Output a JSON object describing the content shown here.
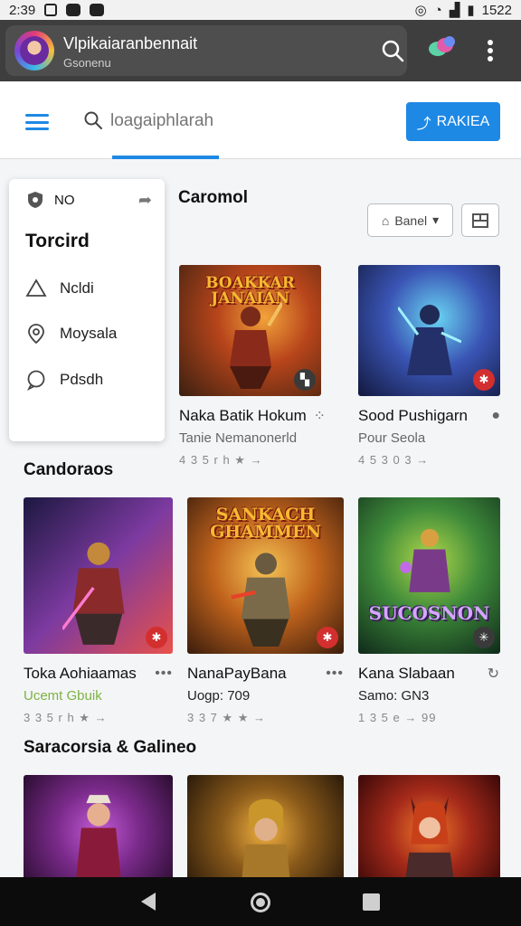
{
  "status_bar": {
    "time": "2:39",
    "right_time": "1522"
  },
  "app_bar": {
    "title": "Vlpikaiaranbennait",
    "subtitle": "Gsonenu",
    "icons": [
      "search-icon",
      "app-logo-icon",
      "more-vert-icon"
    ]
  },
  "toolbar": {
    "search_placeholder": "loagaiphlarah",
    "rank_button": "RAKIEA"
  },
  "side_menu": {
    "top_label": "NO",
    "heading": "Torcird",
    "items": [
      {
        "label": "Ncldi",
        "icon": "triangle-icon"
      },
      {
        "label": "Moysala",
        "icon": "pin-icon"
      },
      {
        "label": "Pdsdh",
        "icon": "chat-bubble-icon"
      }
    ]
  },
  "sections": {
    "featured_title": "Caromol",
    "filter_label": "Banel",
    "second_title": "Candoraos",
    "third_title": "Saracorsia & Galineo"
  },
  "row1": [
    {
      "banner": "BOAKKAR JANAIAN",
      "title": "Naka Batik Hokum",
      "sub": "Tanie Nemanonerld",
      "meta": "4 3 5 r h ★ →",
      "colors": [
        "#3a2010",
        "#b8451b",
        "#f2a33a"
      ]
    },
    {
      "banner": "",
      "title": "Sood Pushigarn",
      "sub": "Pour Seola",
      "meta": "4 5 3 0 3 →",
      "colors": [
        "#12183d",
        "#3a55b5",
        "#69d4f2"
      ]
    }
  ],
  "row2": [
    {
      "banner": "",
      "title": "Toka Aohiaamas",
      "sub": "Ucemt Gbuik",
      "meta": "3 3 5 r h ★ →",
      "colors": [
        "#1c1840",
        "#7c3aa0",
        "#e8514a"
      ]
    },
    {
      "banner": "SANKACH GHAMMEN",
      "title": "NanaPayBana",
      "sub": "Uogp: 709",
      "meta": "3 3 7 ★ ★ →",
      "colors": [
        "#3a1c0c",
        "#c0631c",
        "#f5c455"
      ]
    },
    {
      "banner": "SUCOSNON",
      "title": "Kana Slabaan",
      "sub": "Samo: GN3",
      "meta": "1 3 5 e → 99",
      "colors": [
        "#0f2a1a",
        "#3e8a3a",
        "#b0d84a"
      ]
    }
  ],
  "row3": [
    {
      "colors": [
        "#2a0d30",
        "#7a2a8a",
        "#c25ad6"
      ]
    },
    {
      "colors": [
        "#2a1a0a",
        "#8a5a1a",
        "#f0b040"
      ]
    },
    {
      "colors": [
        "#3a0808",
        "#a52a1a",
        "#f07a2a"
      ]
    }
  ]
}
